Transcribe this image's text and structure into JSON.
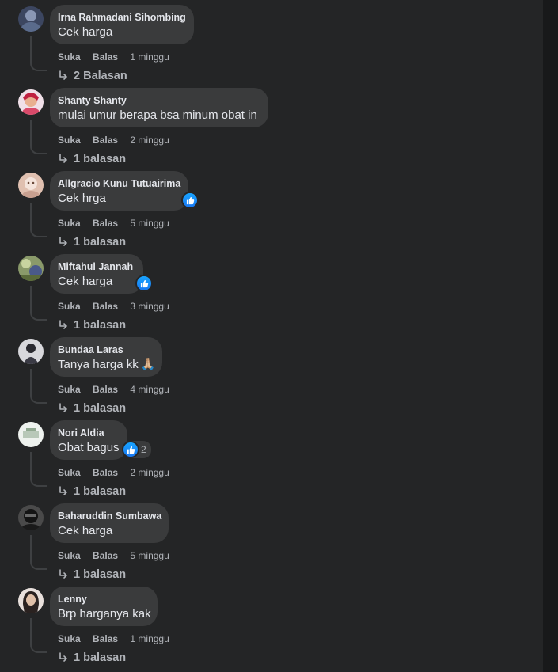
{
  "labels": {
    "like": "Suka",
    "reply": "Balas"
  },
  "comments": [
    {
      "author": "Irna Rahmadani Sihombing",
      "text": "Cek harga",
      "time": "1 minggu",
      "replies": "2 Balasan",
      "avatar_color": "#5a6b8c"
    },
    {
      "author": "Shanty Shanty",
      "text": "mulai umur berapa bsa minum obat in",
      "time": "2 minggu",
      "replies": "1 balasan",
      "avatar_color": "#d94a6a"
    },
    {
      "author": "Allgracio Kunu Tutuairima",
      "text": "Cek hrga",
      "time": "5 minggu",
      "replies": "1 balasan",
      "avatar_color": "#e8c8b8"
    },
    {
      "author": "Miftahul Jannah",
      "text": "Cek harga",
      "time": "3 minggu",
      "replies": "1 balasan",
      "avatar_color": "#6a7a4a"
    },
    {
      "author": "Bundaa Laras",
      "text": "Tanya harga kk",
      "emoji": "🙏🏼",
      "time": "4 minggu",
      "replies": "1 balasan",
      "avatar_color": "#3a3a44"
    },
    {
      "author": "Nori Aldia",
      "text": "Obat bagus",
      "like_count": "2",
      "time": "2 minggu",
      "replies": "1 balasan",
      "avatar_color": "#d8e0d8"
    },
    {
      "author": "Baharuddin Sumbawa",
      "text": "Cek harga",
      "time": "5 minggu",
      "replies": "1 balasan",
      "avatar_color": "#1a1a1a"
    },
    {
      "author": "Lenny",
      "text": "Brp harganya kak",
      "time": "1 minggu",
      "replies": "1 balasan",
      "avatar_color": "#c8b8b0"
    }
  ]
}
